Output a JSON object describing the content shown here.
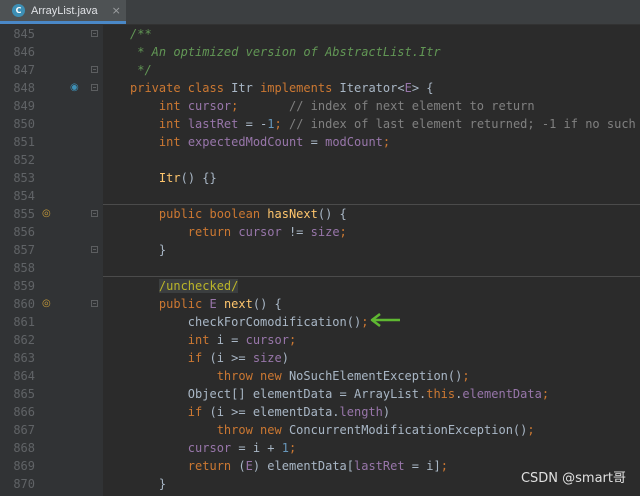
{
  "tab": {
    "filename": "ArrayList.java",
    "icon": "java-class-icon",
    "close": "×"
  },
  "watermark": "CSDN @smart哥",
  "lines": [
    {
      "n": "845",
      "code": [
        [
          "jd",
          "/**"
        ]
      ],
      "fold": true
    },
    {
      "n": "846",
      "code": [
        [
          "jd",
          " * An optimized version of AbstractList.Itr"
        ]
      ]
    },
    {
      "n": "847",
      "code": [
        [
          "jd",
          " */"
        ]
      ],
      "fold": true
    },
    {
      "n": "848",
      "code": [
        [
          "kw",
          "private class "
        ],
        [
          "tx",
          "Itr "
        ],
        [
          "kw",
          "implements "
        ],
        [
          "tx",
          "Iterator<"
        ],
        [
          "fd",
          "E"
        ],
        [
          "tx",
          "> {"
        ]
      ],
      "fold": true,
      "gutter_icon": "implementation-icon"
    },
    {
      "n": "849",
      "code": [
        [
          "tx",
          "    "
        ],
        [
          "kw",
          "int "
        ],
        [
          "fd",
          "cursor"
        ],
        [
          "kw",
          ";       "
        ],
        [
          "cm",
          "// index of next element to return"
        ]
      ]
    },
    {
      "n": "850",
      "code": [
        [
          "tx",
          "    "
        ],
        [
          "kw",
          "int "
        ],
        [
          "fd",
          "lastRet "
        ],
        [
          "tx",
          "= -"
        ],
        [
          "nm",
          "1"
        ],
        [
          "kw",
          "; "
        ],
        [
          "cm",
          "// index of last element returned; -1 if no such"
        ]
      ]
    },
    {
      "n": "851",
      "code": [
        [
          "tx",
          "    "
        ],
        [
          "kw",
          "int "
        ],
        [
          "fd",
          "expectedModCount "
        ],
        [
          "tx",
          "= "
        ],
        [
          "fd",
          "modCount"
        ],
        [
          "kw",
          ";"
        ]
      ]
    },
    {
      "n": "852",
      "code": []
    },
    {
      "n": "853",
      "code": [
        [
          "tx",
          "    "
        ],
        [
          "fn",
          "Itr"
        ],
        [
          "tx",
          "() {}"
        ]
      ]
    },
    {
      "n": "854",
      "code": [],
      "separator_after": true
    },
    {
      "n": "855",
      "code": [
        [
          "tx",
          "    "
        ],
        [
          "kw",
          "public boolean "
        ],
        [
          "fn",
          "hasNext"
        ],
        [
          "tx",
          "() {"
        ]
      ],
      "fold": true,
      "gutter_icon": "override-icon"
    },
    {
      "n": "856",
      "code": [
        [
          "tx",
          "        "
        ],
        [
          "kw",
          "return "
        ],
        [
          "fd",
          "cursor "
        ],
        [
          "tx",
          "!= "
        ],
        [
          "fd",
          "size"
        ],
        [
          "kw",
          ";"
        ]
      ]
    },
    {
      "n": "857",
      "code": [
        [
          "tx",
          "    }"
        ]
      ],
      "fold": true
    },
    {
      "n": "858",
      "code": [],
      "separator_after": true
    },
    {
      "n": "859",
      "code": [
        [
          "tx",
          "    "
        ],
        [
          "an",
          "/unchecked/"
        ]
      ]
    },
    {
      "n": "860",
      "code": [
        [
          "tx",
          "    "
        ],
        [
          "kw",
          "public "
        ],
        [
          "fd",
          "E "
        ],
        [
          "fn",
          "next"
        ],
        [
          "tx",
          "() {"
        ]
      ],
      "fold": true,
      "gutter_icon": "override-icon"
    },
    {
      "n": "861",
      "code": [
        [
          "tx",
          "        checkForComodification()"
        ],
        [
          "kw",
          ";"
        ]
      ]
    },
    {
      "n": "862",
      "code": [
        [
          "tx",
          "        "
        ],
        [
          "kw",
          "int "
        ],
        [
          "tx",
          "i = "
        ],
        [
          "fd",
          "cursor"
        ],
        [
          "kw",
          ";"
        ]
      ]
    },
    {
      "n": "863",
      "code": [
        [
          "tx",
          "        "
        ],
        [
          "kw",
          "if "
        ],
        [
          "tx",
          "(i >= "
        ],
        [
          "fd",
          "size"
        ],
        [
          "tx",
          ")"
        ]
      ]
    },
    {
      "n": "864",
      "code": [
        [
          "tx",
          "            "
        ],
        [
          "kw",
          "throw new "
        ],
        [
          "tx",
          "NoSuchElementException()"
        ],
        [
          "kw",
          ";"
        ]
      ]
    },
    {
      "n": "865",
      "code": [
        [
          "tx",
          "        Object[] elementData = ArrayList."
        ],
        [
          "kw",
          "this"
        ],
        [
          "tx",
          "."
        ],
        [
          "fd",
          "elementData"
        ],
        [
          "kw",
          ";"
        ]
      ]
    },
    {
      "n": "866",
      "code": [
        [
          "tx",
          "        "
        ],
        [
          "kw",
          "if "
        ],
        [
          "tx",
          "(i >= elementData."
        ],
        [
          "fd",
          "length"
        ],
        [
          "tx",
          ")"
        ]
      ]
    },
    {
      "n": "867",
      "code": [
        [
          "tx",
          "            "
        ],
        [
          "kw",
          "throw new "
        ],
        [
          "tx",
          "ConcurrentModificationException()"
        ],
        [
          "kw",
          ";"
        ]
      ]
    },
    {
      "n": "868",
      "code": [
        [
          "tx",
          "        "
        ],
        [
          "fd",
          "cursor "
        ],
        [
          "tx",
          "= i + "
        ],
        [
          "nm",
          "1"
        ],
        [
          "kw",
          ";"
        ]
      ]
    },
    {
      "n": "869",
      "code": [
        [
          "tx",
          "        "
        ],
        [
          "kw",
          "return "
        ],
        [
          "tx",
          "("
        ],
        [
          "fd",
          "E"
        ],
        [
          "tx",
          ") elementData["
        ],
        [
          "fd",
          "lastRet "
        ],
        [
          "tx",
          "= i]"
        ],
        [
          "kw",
          ";"
        ]
      ]
    },
    {
      "n": "870",
      "code": [
        [
          "tx",
          "    }"
        ]
      ]
    }
  ],
  "colors": {
    "background": "#2b2b2b",
    "gutter": "#313335",
    "keyword": "#cc7832",
    "comment": "#808080",
    "doc_comment": "#629755",
    "field": "#9876aa",
    "method": "#ffc66d",
    "number": "#6897bb",
    "text": "#a9b7c6",
    "arrow": "#5fb832"
  }
}
